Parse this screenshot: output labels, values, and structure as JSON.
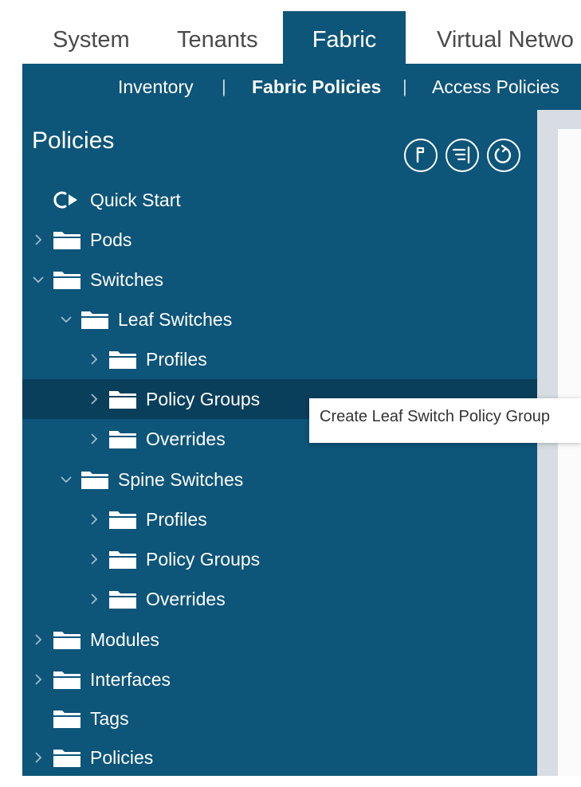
{
  "top_tabs": [
    "System",
    "Tenants",
    "Fabric",
    "Virtual Netwo"
  ],
  "subnav": {
    "items": [
      "Inventory",
      "Fabric Policies",
      "Access Policies"
    ],
    "separator": "|"
  },
  "panel": {
    "title": "Policies",
    "header_icons": [
      "flag-icon",
      "list-icon",
      "refresh-icon"
    ]
  },
  "tree": [
    {
      "label": "Quick Start",
      "icon": "quick-start-icon",
      "expanded": null
    },
    {
      "label": "Pods",
      "icon": "folder-icon",
      "expanded": false
    },
    {
      "label": "Switches",
      "icon": "folder-icon",
      "expanded": true
    },
    {
      "label": "Leaf Switches",
      "icon": "folder-icon",
      "expanded": true
    },
    {
      "label": "Profiles",
      "icon": "folder-icon",
      "expanded": false
    },
    {
      "label": "Policy Groups",
      "icon": "folder-icon",
      "expanded": false
    },
    {
      "label": "Overrides",
      "icon": "folder-icon",
      "expanded": false
    },
    {
      "label": "Spine Switches",
      "icon": "folder-icon",
      "expanded": true
    },
    {
      "label": "Profiles",
      "icon": "folder-icon",
      "expanded": false
    },
    {
      "label": "Policy Groups",
      "icon": "folder-icon",
      "expanded": false
    },
    {
      "label": "Overrides",
      "icon": "folder-icon",
      "expanded": false
    },
    {
      "label": "Modules",
      "icon": "folder-icon",
      "expanded": false
    },
    {
      "label": "Interfaces",
      "icon": "folder-icon",
      "expanded": false
    },
    {
      "label": "Tags",
      "icon": "folder-icon",
      "expanded": null
    },
    {
      "label": "Policies",
      "icon": "folder-icon",
      "expanded": false
    }
  ],
  "tooltip": "Create Leaf Switch Policy Group",
  "colors": {
    "panel": "#0d5579",
    "selected_row": "#0a3f5c",
    "text_light": "#ffffff",
    "tab_inactive_text": "#4a4a4a"
  }
}
